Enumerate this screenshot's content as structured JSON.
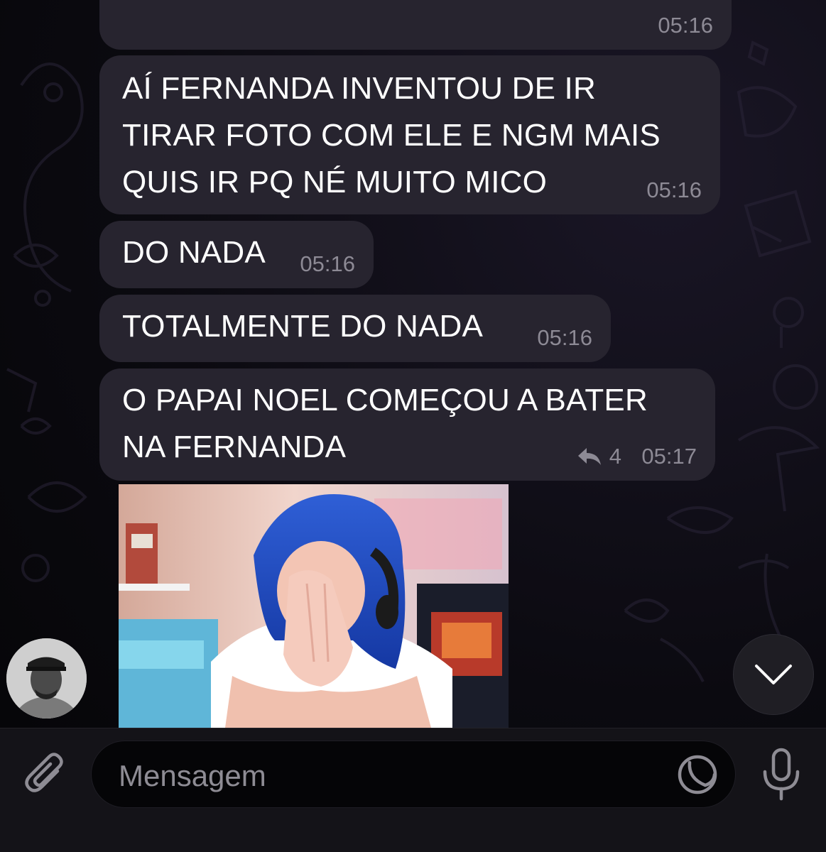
{
  "messages": [
    {
      "text": "",
      "time": "05:16"
    },
    {
      "text": "AÍ FERNANDA INVENTOU DE IR\nTIRAR FOTO COM ELE E NGM MAIS\nQUIS IR PQ NÉ MUITO MICO",
      "time": "05:16"
    },
    {
      "text": "DO NADA",
      "time": "05:16"
    },
    {
      "text": "TOTALMENTE DO NADA",
      "time": "05:16"
    },
    {
      "text": "O PAPAI NOEL COMEÇOU A BATER\nNA FERNANDA",
      "time": "05:17",
      "reply_count": "4"
    }
  ],
  "composer": {
    "placeholder": "Mensagem"
  },
  "icons": {
    "attach": "paperclip-icon",
    "sticker": "sticker-icon",
    "mic": "microphone-icon",
    "reply": "reply-arrow-icon",
    "scroll": "chevron-down-icon"
  },
  "colors": {
    "bubble": "#27242f",
    "time": "#8d8a95",
    "bar": "#141318"
  }
}
